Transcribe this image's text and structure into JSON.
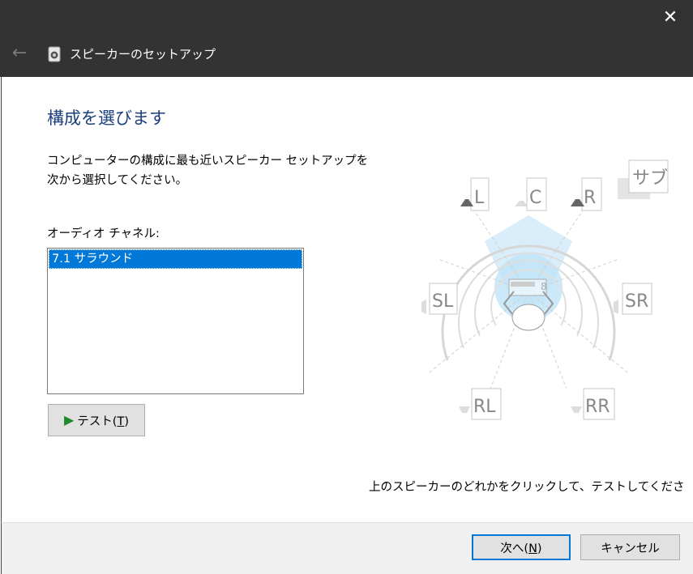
{
  "window": {
    "title": "スピーカーのセットアップ",
    "close_glyph": "✕",
    "back_glyph": "←"
  },
  "page": {
    "heading": "構成を選びます",
    "instruction_line1": "コンピューターの構成に最も近いスピーカー セットアップを",
    "instruction_line2": "次から選択してください。",
    "channels_label": "オーディオ チャネル:",
    "channels": [
      "7.1 サラウンド"
    ],
    "test_button_prefix": "テスト(",
    "test_button_key": "T",
    "test_button_suffix": ")",
    "hint": "上のスピーカーのどれかをクリックして、テストしてくださ"
  },
  "speakers": {
    "left": "L",
    "center": "C",
    "right": "R",
    "sub": "サブ",
    "side_left": "SL",
    "side_right": "SR",
    "rear_left": "RL",
    "rear_right": "RR"
  },
  "footer": {
    "next_prefix": "次へ(",
    "next_key": "N",
    "next_suffix": ")",
    "cancel": "キャンセル"
  },
  "colors": {
    "titlebar": "#333333",
    "heading": "#1a3f7a",
    "selection": "#0078d7",
    "play": "#1e8a2b",
    "listening_zone": "#bfe3f7"
  }
}
